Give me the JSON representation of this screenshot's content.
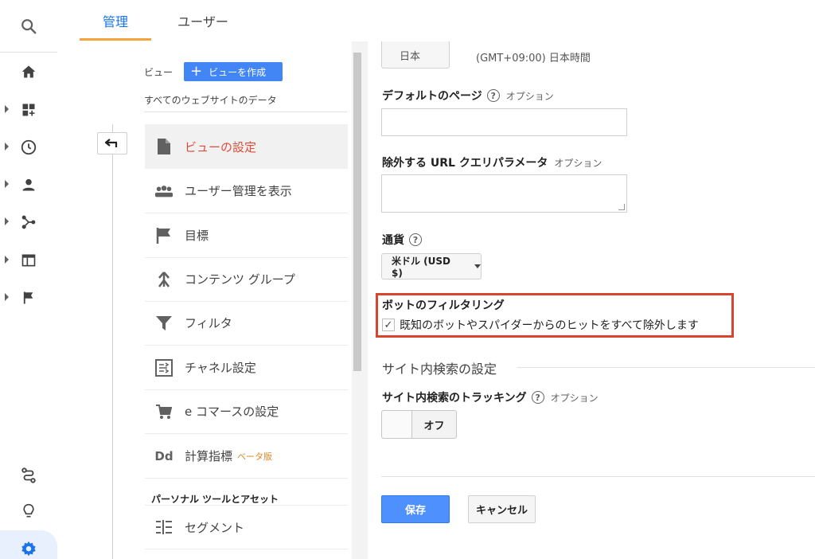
{
  "tabs": [
    {
      "label": "管理"
    },
    {
      "label": "ユーザー"
    }
  ],
  "view": {
    "label": "ビュー",
    "create_button": "ビューを作成",
    "selected_view": "すべてのウェブサイトのデータ"
  },
  "menu": [
    {
      "label": "ビューの設定",
      "icon": "document-icon"
    },
    {
      "label": "ユーザー管理を表示",
      "icon": "people-icon"
    },
    {
      "label": "目標",
      "icon": "flag-icon"
    },
    {
      "label": "コンテンツ グループ",
      "icon": "content-group-icon"
    },
    {
      "label": "フィルタ",
      "icon": "filter-icon"
    },
    {
      "label": "チャネル設定",
      "icon": "channel-icon"
    },
    {
      "label": "e コマースの設定",
      "icon": "cart-icon"
    },
    {
      "label": "計算指標",
      "icon": "dd-icon",
      "badge": "ベータ版"
    }
  ],
  "personal_section": {
    "title": "パーソナル ツールとアセット",
    "items": [
      {
        "label": "セグメント",
        "icon": "segment-icon"
      }
    ]
  },
  "form": {
    "timezone_country": "日本",
    "timezone_value": "(GMT+09:00) 日本時間",
    "default_page": {
      "label": "デフォルトのページ",
      "option": "オプション",
      "value": ""
    },
    "exclude_params": {
      "label": "除外する URL クエリパラメータ",
      "option": "オプション",
      "value": ""
    },
    "currency": {
      "label": "通貨",
      "value": "米ドル (USD $)"
    },
    "bot_filtering": {
      "label": "ボットのフィルタリング",
      "checkbox_label": "既知のボットやスパイダーからのヒットをすべて除外します",
      "checked": true
    },
    "site_search": {
      "title": "サイト内検索の設定",
      "tracking_label": "サイト内検索のトラッキング",
      "option": "オプション",
      "toggle_value": "オフ"
    },
    "save_label": "保存",
    "cancel_label": "キャンセル"
  },
  "colors": {
    "accent_blue": "#1a73e8",
    "selected_red": "#dd4b39",
    "highlight_box": "#d9442e",
    "tab_underline": "#f6a33c"
  }
}
